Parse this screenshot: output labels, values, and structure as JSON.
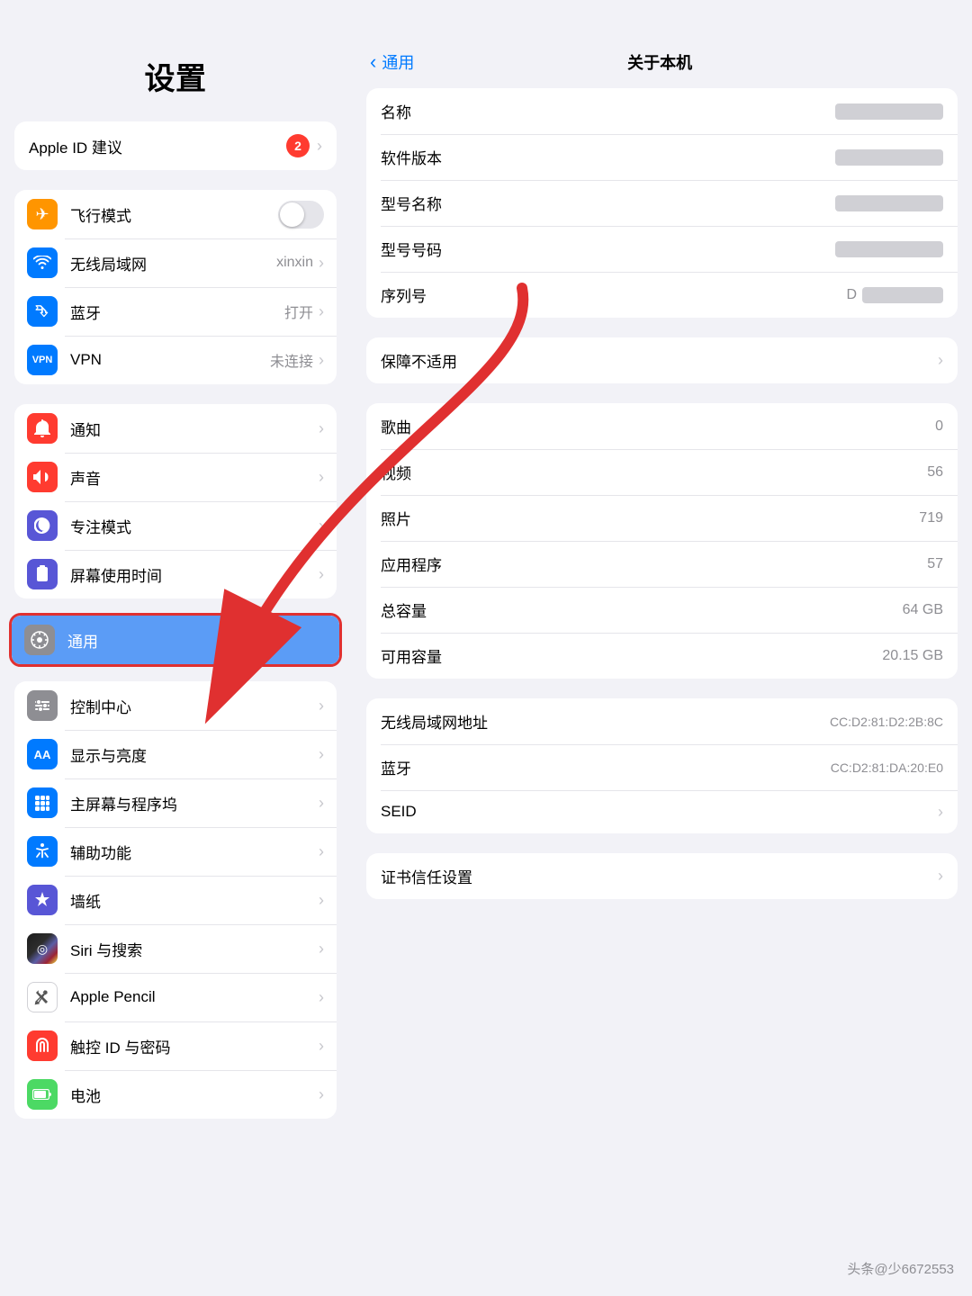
{
  "left": {
    "title": "设置",
    "apple_id": {
      "label": "Apple ID 建议",
      "badge": "2"
    },
    "group1": [
      {
        "id": "airplane",
        "label": "飞行模式",
        "icon_color": "#ff9500",
        "icon": "✈",
        "has_toggle": true,
        "toggle_on": false
      },
      {
        "id": "wifi",
        "label": "无线局域网",
        "icon_color": "#007aff",
        "icon": "wifi",
        "value": "xinxin"
      },
      {
        "id": "bluetooth",
        "label": "蓝牙",
        "icon_color": "#007aff",
        "icon": "bluetooth",
        "value": "打开"
      },
      {
        "id": "vpn",
        "label": "VPN",
        "icon_color": "#007aff",
        "icon": "VPN",
        "value": "未连接"
      }
    ],
    "group2": [
      {
        "id": "notify",
        "label": "通知",
        "icon_color": "#ff3b30",
        "icon": "bell"
      },
      {
        "id": "sound",
        "label": "声音",
        "icon_color": "#ff3b30",
        "icon": "sound"
      },
      {
        "id": "focus",
        "label": "专注模式",
        "icon_color": "#5856d6",
        "icon": "moon"
      },
      {
        "id": "screentime",
        "label": "屏幕使用时间",
        "icon_color": "#5856d6",
        "icon": "hourglass"
      }
    ],
    "group3_selected": [
      {
        "id": "general",
        "label": "通用",
        "icon_color": "#8e8e93",
        "icon": "gear",
        "selected": true
      }
    ],
    "group4": [
      {
        "id": "control",
        "label": "控制中心",
        "icon_color": "#8e8e93",
        "icon": "sliders"
      },
      {
        "id": "display",
        "label": "显示与亮度",
        "icon_color": "#007aff",
        "icon": "AA"
      },
      {
        "id": "homescreen",
        "label": "主屏幕与程序坞",
        "icon_color": "#007aff",
        "icon": "grid"
      },
      {
        "id": "accessibility",
        "label": "辅助功能",
        "icon_color": "#007aff",
        "icon": "access"
      },
      {
        "id": "wallpaper",
        "label": "墙纸",
        "icon_color": "#007aff",
        "icon": "flower"
      },
      {
        "id": "siri",
        "label": "Siri 与搜索",
        "icon_color": "#000",
        "icon": "siri"
      },
      {
        "id": "pencil",
        "label": "Apple Pencil",
        "icon_color": "#fff",
        "icon": "pencil",
        "border": true
      },
      {
        "id": "touchid",
        "label": "触控 ID 与密码",
        "icon_color": "#ff3b30",
        "icon": "finger"
      },
      {
        "id": "battery",
        "label": "电池",
        "icon_color": "#4cd964",
        "icon": "battery"
      }
    ]
  },
  "right": {
    "back_label": "通用",
    "title": "关于本机",
    "info_group1": [
      {
        "id": "name",
        "label": "名称",
        "value": "",
        "blurred": true
      },
      {
        "id": "software",
        "label": "软件版本",
        "value": "",
        "blurred": true
      },
      {
        "id": "model_name",
        "label": "型号名称",
        "value": "",
        "blurred": true
      },
      {
        "id": "model_number",
        "label": "型号号码",
        "value": "",
        "blurred": true
      },
      {
        "id": "serial",
        "label": "序列号",
        "value": "D",
        "partial": true
      }
    ],
    "info_group2": [
      {
        "id": "warranty",
        "label": "保障不适用",
        "value": "",
        "chevron": true
      }
    ],
    "info_group3": [
      {
        "id": "songs",
        "label": "歌曲",
        "value": "0"
      },
      {
        "id": "videos",
        "label": "视频",
        "value": "56"
      },
      {
        "id": "photos",
        "label": "照片",
        "value": "719"
      },
      {
        "id": "apps",
        "label": "应用程序",
        "value": "57"
      },
      {
        "id": "capacity",
        "label": "总容量",
        "value": "64 GB"
      },
      {
        "id": "available",
        "label": "可用容量",
        "value": "20.15 GB"
      }
    ],
    "info_group4": [
      {
        "id": "wifi_addr",
        "label": "无线局域网地址",
        "value": "CC:D2:81:D2:2B:8C"
      },
      {
        "id": "bt_addr",
        "label": "蓝牙",
        "value": "CC:D2:81:DA:20:E0"
      },
      {
        "id": "seid",
        "label": "SEID",
        "value": "",
        "chevron": true
      }
    ],
    "info_group5": [
      {
        "id": "cert",
        "label": "证书信任设置",
        "value": "",
        "chevron": true
      }
    ]
  },
  "watermark": "头条@少6672553",
  "arrow": {
    "visible": true
  }
}
